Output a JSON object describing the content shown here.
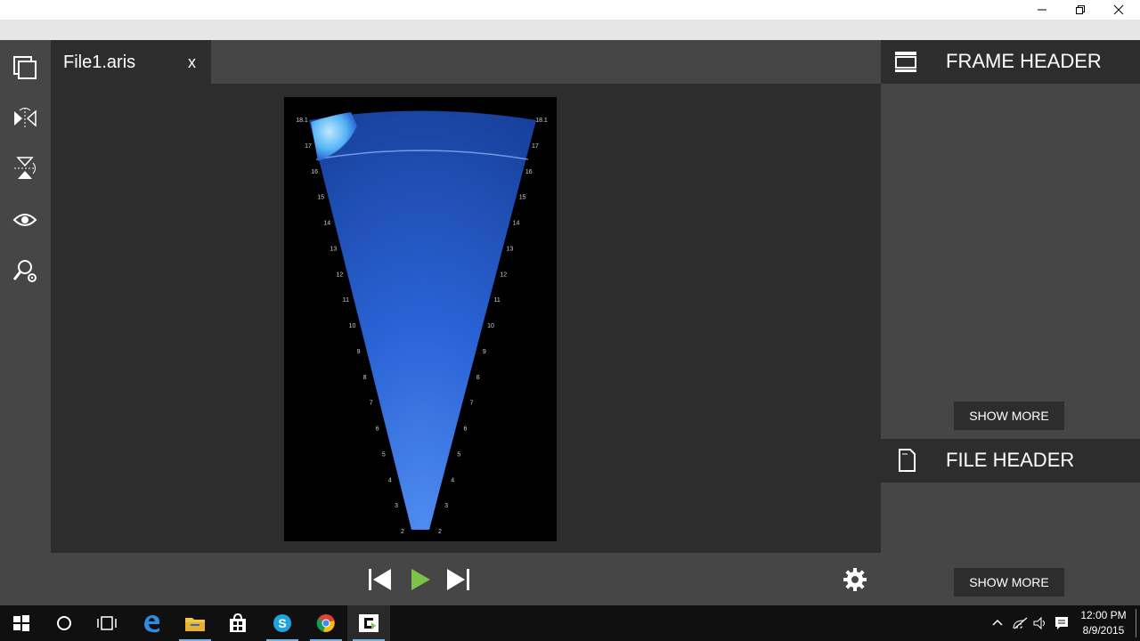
{
  "window": {
    "controls": [
      "minimize",
      "restore",
      "close"
    ]
  },
  "tab": {
    "title": "File1.aris",
    "close_label": "x"
  },
  "sonar": {
    "range_labels": [
      "18.1",
      "17",
      "16",
      "15",
      "14",
      "13",
      "12",
      "11",
      "10",
      "9",
      "8",
      "7",
      "6",
      "5",
      "4",
      "3",
      "2"
    ]
  },
  "right_panel": {
    "frame_header": {
      "title": "FRAME HEADER",
      "icon": "frame-icon",
      "show_more_label": "SHOW MORE"
    },
    "file_header": {
      "title": "FILE HEADER",
      "icon": "document-icon",
      "show_more_label": "SHOW MORE"
    }
  },
  "left_toolbar": {
    "icons": [
      "copy-icon",
      "flip-horizontal-icon",
      "flip-vertical-icon",
      "eye-icon",
      "search-settings-icon"
    ]
  },
  "playback": {
    "icons": [
      "previous-frame-icon",
      "play-icon",
      "next-frame-icon"
    ],
    "play_color": "#7dc24a",
    "settings_icon": "gear-icon"
  },
  "taskbar": {
    "icons": [
      "windows-start-icon",
      "cortana-icon",
      "task-view-icon",
      "edge-icon",
      "file-explorer-icon",
      "store-icon",
      "skype-icon",
      "chrome-icon",
      "aris-app-icon"
    ],
    "clock_time": "12:00 PM",
    "clock_date": "8/9/2015",
    "accent": "#7ab0e0"
  },
  "colors": {
    "panel_dark": "#2d2d2d",
    "panel_mid": "#464646",
    "sonar_blue": "#1f56c8"
  }
}
